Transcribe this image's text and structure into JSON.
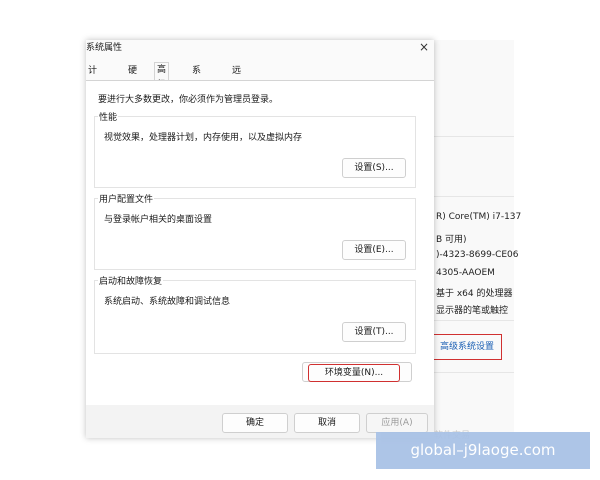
{
  "dialog": {
    "title": "系统属性",
    "tabs": [
      {
        "label": "计算机名"
      },
      {
        "label": "硬件"
      },
      {
        "label": "高级"
      },
      {
        "label": "系统保护"
      },
      {
        "label": "远程"
      }
    ],
    "note": "要进行大多数更改，你必须作为管理员登录。",
    "performance": {
      "title": "性能",
      "desc": "视觉效果，处理器计划，内存使用，以及虚拟内存",
      "button": "设置(S)..."
    },
    "user_profiles": {
      "title": "用户配置文件",
      "desc": "与登录帐户相关的桌面设置",
      "button": "设置(E)..."
    },
    "startup_recovery": {
      "title": "启动和故障恢复",
      "desc": "系统启动、系统故障和调试信息",
      "button": "设置(T)..."
    },
    "env_button": "环境变量(N)...",
    "ok": "确定",
    "cancel": "取消",
    "apply": "应用(A)",
    "close_icon": "×"
  },
  "background": {
    "lines": [
      "R) Core(TM) i7-137",
      "B 可用)",
      ")-4323-8699-CE06",
      "4305-AAOEM",
      "基于 x64 的处理器",
      "显示器的笔或触控"
    ],
    "advanced_link": "高级系统设置",
    "faint_text": "软件交易"
  },
  "watermark": "global–j9laoge.com"
}
